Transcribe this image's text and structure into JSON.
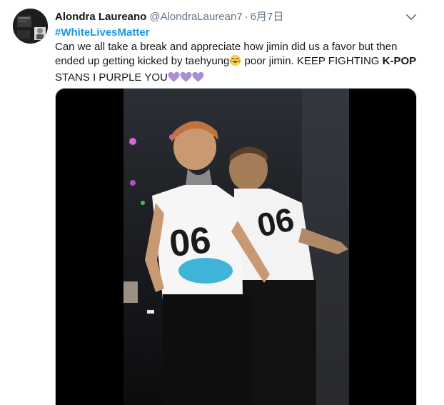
{
  "tweet": {
    "author_name": "Alondra Laureano",
    "author_handle": "@AlondraLaurean7",
    "separator": "·",
    "date": "6月7日",
    "hashtag": "#WhiteLivesMatter",
    "text_line1": "Can we all take a break and appreciate how jimin did us a favor but then",
    "text_line2_a": "ended up getting kicked by taehyung",
    "text_line2_b": " poor jimin. KEEP FIGHTING ",
    "text_line2_bold": "K-POP",
    "text_line3": "STANS I PURPLE YOU",
    "shirt_text_left": "06",
    "shirt_text_right": "06"
  },
  "icons": {
    "avatar": "avatar",
    "menu": "chevron-down-icon",
    "laugh_emoji": "face-with-tears-of-joy-icon",
    "hearts": "purple-heart-icon"
  },
  "colors": {
    "link": "#1b95e0",
    "text": "#14171a",
    "secondary": "#657786",
    "purple_heart": "#aa8ed6"
  }
}
